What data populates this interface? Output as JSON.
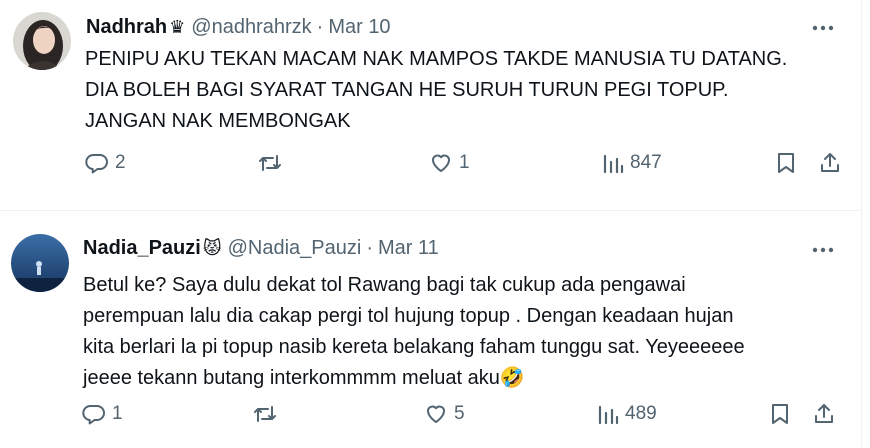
{
  "tweets": [
    {
      "name": "Nadhrah",
      "name_emoji": "♛",
      "handle": "@nadhrahrzk",
      "date": "Mar 10",
      "text_lines": [
        "PENIPU AKU TEKAN MACAM NAK MAMPOS TAKDE MANUSIA TU DATANG.",
        "DIA BOLEH BAGI SYARAT TANGAN HE SURUH TURUN PEGI TOPUP.",
        "JANGAN NAK MEMBONGAK"
      ],
      "replies": "2",
      "retweets": "",
      "likes": "1",
      "views": "847"
    },
    {
      "name": "Nadia_Pauzi",
      "name_emoji": "😾",
      "handle": "@Nadia_Pauzi",
      "date": "Mar 11",
      "text_lines": [
        "Betul ke? Saya dulu dekat tol Rawang bagi tak cukup ada pengawai",
        "perempuan lalu dia cakap pergi tol hujung topup . Dengan keadaan hujan",
        "kita berlari la pi topup nasib kereta belakang faham tunggu sat. Yeyeeeeee",
        "jeeee tekann butang interkommmm meluat aku🤣"
      ],
      "replies": "1",
      "retweets": "",
      "likes": "5",
      "views": "489"
    }
  ],
  "icons": {
    "reply": "reply-icon",
    "retweet": "retweet-icon",
    "like": "heart-icon",
    "views": "views-icon",
    "bookmark": "bookmark-icon",
    "share": "share-icon",
    "more": "more-icon"
  },
  "colors": {
    "text": "#0f1419",
    "secondary": "#536471",
    "border": "#eff3f4"
  }
}
